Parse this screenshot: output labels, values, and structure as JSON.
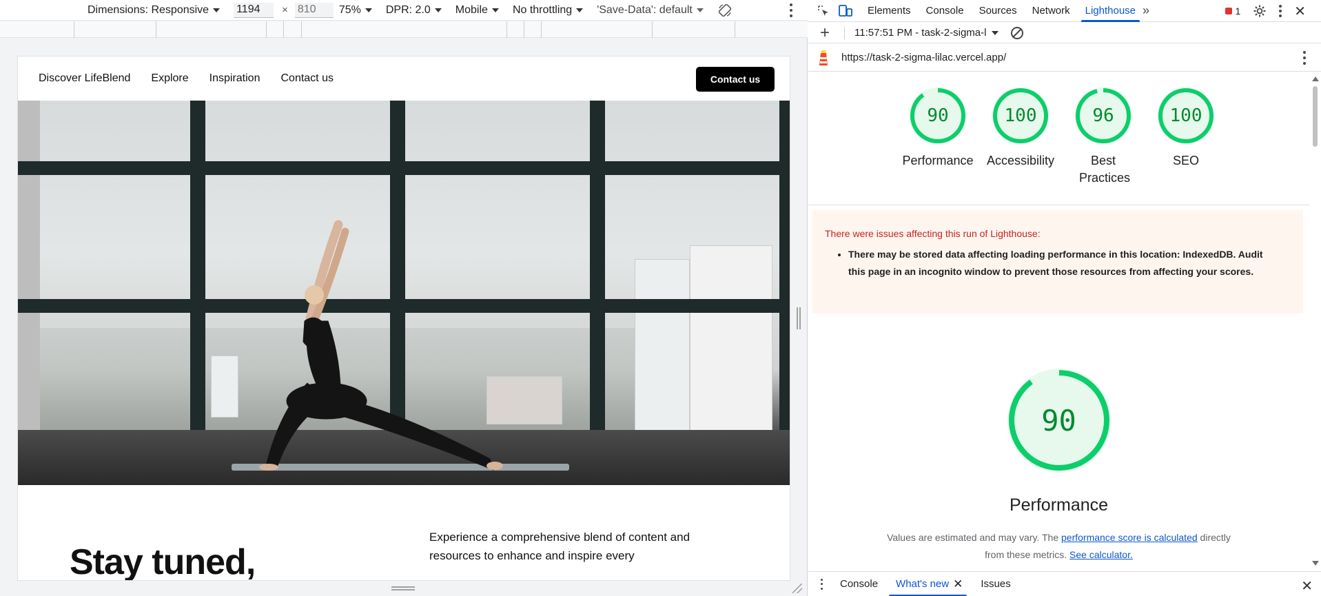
{
  "device_toolbar": {
    "dimensions_label": "Dimensions: Responsive",
    "width_value": "1194",
    "height_placeholder": "810",
    "zoom": "75%",
    "dpr": "DPR: 2.0",
    "device_type": "Mobile",
    "throttling": "No throttling",
    "save_data": "'Save-Data': default"
  },
  "site": {
    "nav_items": [
      "Discover LifeBlend",
      "Explore",
      "Inspiration",
      "Contact us"
    ],
    "cta": "Contact us",
    "headline": "Stay tuned,",
    "blurb": "Experience a comprehensive blend of content and resources to enhance and inspire every"
  },
  "devtools": {
    "tabs": [
      "Elements",
      "Console",
      "Sources",
      "Network",
      "Lighthouse"
    ],
    "active_tab": "Lighthouse",
    "more_tabs": "»",
    "error_count": "1",
    "report_selector": "11:57:51 PM - task-2-sigma-l",
    "url": "https://task-2-sigma-lilac.vercel.app/",
    "scores": [
      {
        "value": "90",
        "label": "Performance",
        "fraction": 0.9
      },
      {
        "value": "100",
        "label": "Accessibility",
        "fraction": 1.0
      },
      {
        "value": "96",
        "label": "Best Practices",
        "fraction": 0.96
      },
      {
        "value": "100",
        "label": "SEO",
        "fraction": 1.0
      }
    ],
    "warning": {
      "title": "There were issues affecting this run of Lighthouse:",
      "items": [
        "There may be stored data affecting loading performance in this location: IndexedDB. Audit this page in an incognito window to prevent those resources from affecting your scores."
      ]
    },
    "performance": {
      "value": "90",
      "fraction": 0.9,
      "label": "Performance",
      "note_prefix": "Values are estimated and may vary. The ",
      "note_link": "performance score is calculated",
      "note_middle": " directly from these metrics. ",
      "note_link2": "See calculator."
    },
    "drawer_tabs": [
      "Console",
      "What's new",
      "Issues"
    ],
    "active_drawer_tab": "What's new"
  },
  "colors": {
    "accent": "#0b57d0",
    "score_green": "#0cce6b",
    "score_text": "#008a2e",
    "warn_bg": "#fff5ef",
    "warn_title": "#c5221f"
  }
}
